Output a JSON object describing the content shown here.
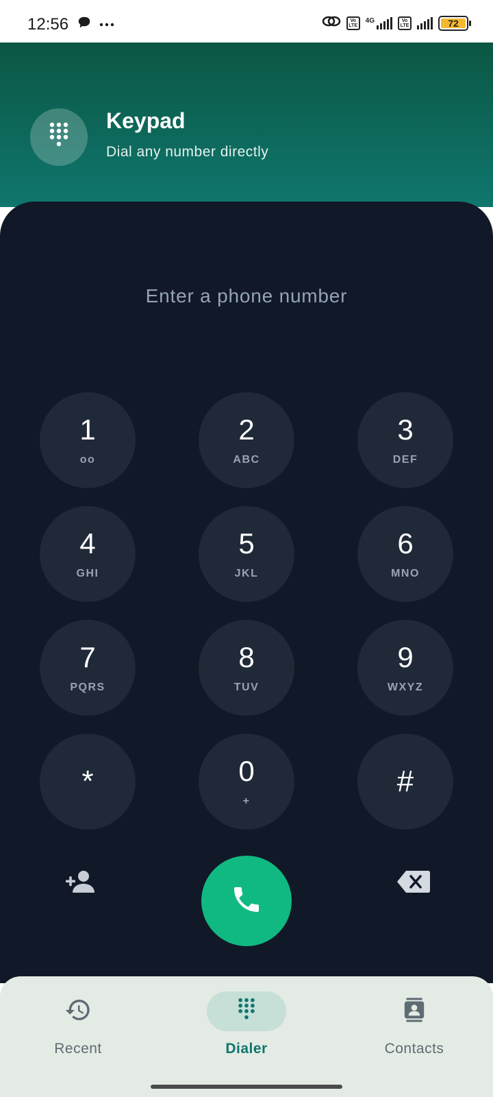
{
  "status_bar": {
    "time": "12:56",
    "network_type": "4G",
    "volte_label": "Vo LTE",
    "battery_level": "72",
    "battery_color": "#f5b82e"
  },
  "header": {
    "icon": "dialpad-icon",
    "title": "Keypad",
    "subtitle": "Dial any number directly",
    "gradient_colors": [
      "#0b5743",
      "#0f766e"
    ]
  },
  "dialer": {
    "placeholder": "Enter a phone number",
    "keys": [
      {
        "digit": "1",
        "letters": "oo"
      },
      {
        "digit": "2",
        "letters": "ABC"
      },
      {
        "digit": "3",
        "letters": "DEF"
      },
      {
        "digit": "4",
        "letters": "GHI"
      },
      {
        "digit": "5",
        "letters": "JKL"
      },
      {
        "digit": "6",
        "letters": "MNO"
      },
      {
        "digit": "7",
        "letters": "PQRS"
      },
      {
        "digit": "8",
        "letters": "TUV"
      },
      {
        "digit": "9",
        "letters": "WXYZ"
      },
      {
        "digit": "*",
        "letters": ""
      },
      {
        "digit": "0",
        "letters": "+"
      },
      {
        "digit": "#",
        "letters": ""
      }
    ],
    "actions": {
      "add_contact_icon": "person-add-icon",
      "call_icon": "phone-icon",
      "call_color": "#10b981",
      "backspace_icon": "backspace-icon"
    }
  },
  "bottom_nav": {
    "items": [
      {
        "label": "Recent",
        "icon": "history-icon",
        "active": false
      },
      {
        "label": "Dialer",
        "icon": "dialpad-icon",
        "active": true
      },
      {
        "label": "Contacts",
        "icon": "contacts-icon",
        "active": false
      }
    ],
    "accent_color": "#0f766e"
  }
}
